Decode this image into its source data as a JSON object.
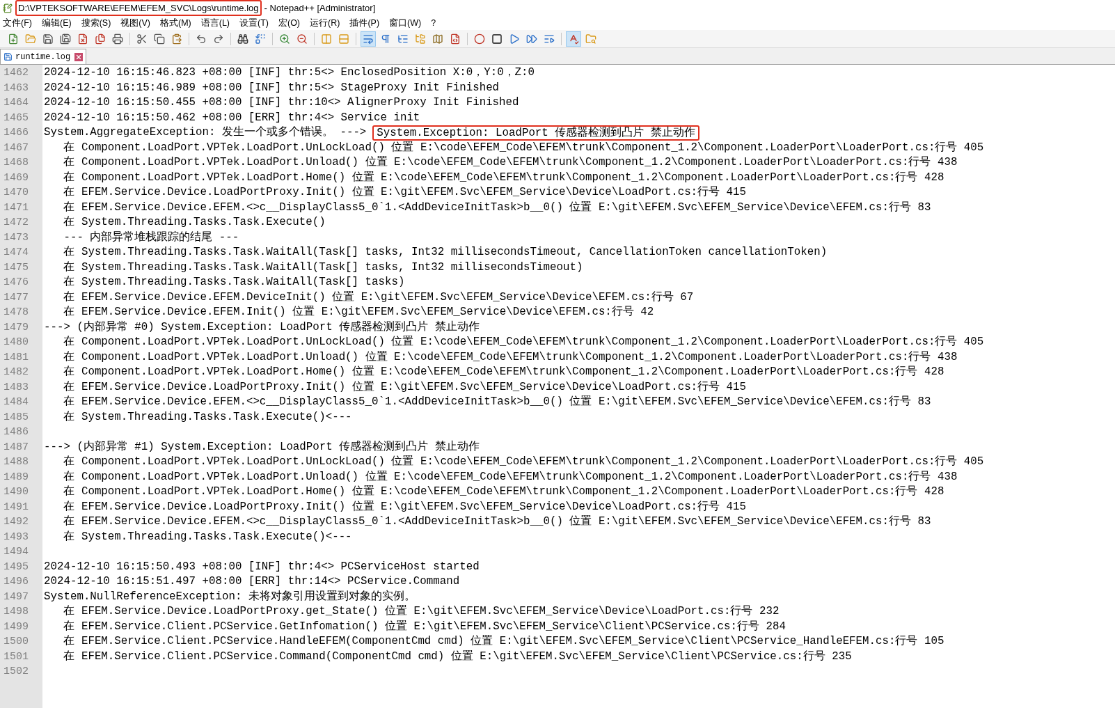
{
  "window": {
    "title_path": "D:\\VPTEKSOFTWARE\\EFEM\\EFEM_SVC\\Logs\\runtime.log",
    "title_path_highlighted": true,
    "title_app": "- Notepad++ [Administrator]"
  },
  "menu": [
    "文件(F)",
    "编辑(E)",
    "搜索(S)",
    "视图(V)",
    "格式(M)",
    "语言(L)",
    "设置(T)",
    "宏(O)",
    "运行(R)",
    "插件(P)",
    "窗口(W)",
    "?"
  ],
  "toolbar": [
    {
      "kind": "button",
      "pressed": false
    },
    {
      "kind": "button",
      "pressed": false
    },
    {
      "kind": "button",
      "pressed": false
    },
    {
      "kind": "button",
      "pressed": false
    },
    {
      "kind": "button",
      "pressed": false
    },
    {
      "kind": "button",
      "pressed": false
    },
    {
      "kind": "button",
      "pressed": false
    },
    {
      "kind": "separator"
    },
    {
      "kind": "button",
      "pressed": false
    },
    {
      "kind": "button",
      "pressed": false
    },
    {
      "kind": "button",
      "pressed": false
    },
    {
      "kind": "separator"
    },
    {
      "kind": "button",
      "pressed": false
    },
    {
      "kind": "button",
      "pressed": false
    },
    {
      "kind": "separator"
    },
    {
      "kind": "button",
      "pressed": false
    },
    {
      "kind": "button",
      "pressed": false
    },
    {
      "kind": "separator"
    },
    {
      "kind": "button",
      "pressed": false
    },
    {
      "kind": "button",
      "pressed": false
    },
    {
      "kind": "separator"
    },
    {
      "kind": "button",
      "pressed": false
    },
    {
      "kind": "button",
      "pressed": false
    },
    {
      "kind": "separator"
    },
    {
      "kind": "button",
      "pressed": true
    },
    {
      "kind": "button",
      "pressed": false
    },
    {
      "kind": "button",
      "pressed": false
    },
    {
      "kind": "button",
      "pressed": false
    },
    {
      "kind": "button",
      "pressed": false
    },
    {
      "kind": "button",
      "pressed": false
    },
    {
      "kind": "separator"
    },
    {
      "kind": "button",
      "pressed": false
    },
    {
      "kind": "button",
      "pressed": false
    },
    {
      "kind": "button",
      "pressed": false
    },
    {
      "kind": "button",
      "pressed": false
    },
    {
      "kind": "button",
      "pressed": false
    },
    {
      "kind": "separator"
    },
    {
      "kind": "button",
      "pressed": true
    },
    {
      "kind": "button",
      "pressed": false
    }
  ],
  "tabs": [
    {
      "label": "runtime.log",
      "selected": true
    }
  ],
  "editor": {
    "lines": [
      {
        "number": "1462",
        "text": "2024-12-10 16:15:46.823 +08:00 [INF] thr:5<> EnclosedPosition X:0，Y:0，Z:0"
      },
      {
        "number": "1463",
        "text": "2024-12-10 16:15:46.989 +08:00 [INF] thr:5<> StageProxy Init Finished"
      },
      {
        "number": "1464",
        "text": "2024-12-10 16:15:50.455 +08:00 [INF] thr:10<> AlignerProxy Init Finished"
      },
      {
        "number": "1465",
        "text": "2024-12-10 16:15:50.462 +08:00 [ERR] thr:4<> Service init"
      },
      {
        "number": "1466",
        "text": "System.AggregateException: 发生一个或多个错误。 --->",
        "highlighted_text": "System.Exception: LoadPort 传感器检测到凸片 禁止动作"
      },
      {
        "number": "1467",
        "text": "   在 Component.LoadPort.VPTek.LoadPort.UnLockLoad() 位置 E:\\code\\EFEM_Code\\EFEM\\trunk\\Component_1.2\\Component.LoaderPort\\LoaderPort.cs:行号 405"
      },
      {
        "number": "1468",
        "text": "   在 Component.LoadPort.VPTek.LoadPort.Unload() 位置 E:\\code\\EFEM_Code\\EFEM\\trunk\\Component_1.2\\Component.LoaderPort\\LoaderPort.cs:行号 438"
      },
      {
        "number": "1469",
        "text": "   在 Component.LoadPort.VPTek.LoadPort.Home() 位置 E:\\code\\EFEM_Code\\EFEM\\trunk\\Component_1.2\\Component.LoaderPort\\LoaderPort.cs:行号 428"
      },
      {
        "number": "1470",
        "text": "   在 EFEM.Service.Device.LoadPortProxy.Init() 位置 E:\\git\\EFEM.Svc\\EFEM_Service\\Device\\LoadPort.cs:行号 415"
      },
      {
        "number": "1471",
        "text": "   在 EFEM.Service.Device.EFEM.<>c__DisplayClass5_0`1.<AddDeviceInitTask>b__0() 位置 E:\\git\\EFEM.Svc\\EFEM_Service\\Device\\EFEM.cs:行号 83"
      },
      {
        "number": "1472",
        "text": "   在 System.Threading.Tasks.Task.Execute()"
      },
      {
        "number": "1473",
        "text": "   --- 内部异常堆栈跟踪的结尾 ---"
      },
      {
        "number": "1474",
        "text": "   在 System.Threading.Tasks.Task.WaitAll(Task[] tasks, Int32 millisecondsTimeout, CancellationToken cancellationToken)"
      },
      {
        "number": "1475",
        "text": "   在 System.Threading.Tasks.Task.WaitAll(Task[] tasks, Int32 millisecondsTimeout)"
      },
      {
        "number": "1476",
        "text": "   在 System.Threading.Tasks.Task.WaitAll(Task[] tasks)"
      },
      {
        "number": "1477",
        "text": "   在 EFEM.Service.Device.EFEM.DeviceInit() 位置 E:\\git\\EFEM.Svc\\EFEM_Service\\Device\\EFEM.cs:行号 67"
      },
      {
        "number": "1478",
        "text": "   在 EFEM.Service.Device.EFEM.Init() 位置 E:\\git\\EFEM.Svc\\EFEM_Service\\Device\\EFEM.cs:行号 42"
      },
      {
        "number": "1479",
        "text": "---> (内部异常 #0) System.Exception: LoadPort 传感器检测到凸片 禁止动作"
      },
      {
        "number": "1480",
        "text": "   在 Component.LoadPort.VPTek.LoadPort.UnLockLoad() 位置 E:\\code\\EFEM_Code\\EFEM\\trunk\\Component_1.2\\Component.LoaderPort\\LoaderPort.cs:行号 405"
      },
      {
        "number": "1481",
        "text": "   在 Component.LoadPort.VPTek.LoadPort.Unload() 位置 E:\\code\\EFEM_Code\\EFEM\\trunk\\Component_1.2\\Component.LoaderPort\\LoaderPort.cs:行号 438"
      },
      {
        "number": "1482",
        "text": "   在 Component.LoadPort.VPTek.LoadPort.Home() 位置 E:\\code\\EFEM_Code\\EFEM\\trunk\\Component_1.2\\Component.LoaderPort\\LoaderPort.cs:行号 428"
      },
      {
        "number": "1483",
        "text": "   在 EFEM.Service.Device.LoadPortProxy.Init() 位置 E:\\git\\EFEM.Svc\\EFEM_Service\\Device\\LoadPort.cs:行号 415"
      },
      {
        "number": "1484",
        "text": "   在 EFEM.Service.Device.EFEM.<>c__DisplayClass5_0`1.<AddDeviceInitTask>b__0() 位置 E:\\git\\EFEM.Svc\\EFEM_Service\\Device\\EFEM.cs:行号 83"
      },
      {
        "number": "1485",
        "text": "   在 System.Threading.Tasks.Task.Execute()<---"
      },
      {
        "number": "1486"
      },
      {
        "number": "1487",
        "text": "---> (内部异常 #1) System.Exception: LoadPort 传感器检测到凸片 禁止动作"
      },
      {
        "number": "1488",
        "text": "   在 Component.LoadPort.VPTek.LoadPort.UnLockLoad() 位置 E:\\code\\EFEM_Code\\EFEM\\trunk\\Component_1.2\\Component.LoaderPort\\LoaderPort.cs:行号 405"
      },
      {
        "number": "1489",
        "text": "   在 Component.LoadPort.VPTek.LoadPort.Unload() 位置 E:\\code\\EFEM_Code\\EFEM\\trunk\\Component_1.2\\Component.LoaderPort\\LoaderPort.cs:行号 438"
      },
      {
        "number": "1490",
        "text": "   在 Component.LoadPort.VPTek.LoadPort.Home() 位置 E:\\code\\EFEM_Code\\EFEM\\trunk\\Component_1.2\\Component.LoaderPort\\LoaderPort.cs:行号 428"
      },
      {
        "number": "1491",
        "text": "   在 EFEM.Service.Device.LoadPortProxy.Init() 位置 E:\\git\\EFEM.Svc\\EFEM_Service\\Device\\LoadPort.cs:行号 415"
      },
      {
        "number": "1492",
        "text": "   在 EFEM.Service.Device.EFEM.<>c__DisplayClass5_0`1.<AddDeviceInitTask>b__0() 位置 E:\\git\\EFEM.Svc\\EFEM_Service\\Device\\EFEM.cs:行号 83"
      },
      {
        "number": "1493",
        "text": "   在 System.Threading.Tasks.Task.Execute()<---"
      },
      {
        "number": "1494"
      },
      {
        "number": "1495",
        "text": "2024-12-10 16:15:50.493 +08:00 [INF] thr:4<> PCServiceHost started"
      },
      {
        "number": "1496",
        "text": "2024-12-10 16:15:51.497 +08:00 [ERR] thr:14<> PCService.Command"
      },
      {
        "number": "1497",
        "text": "System.NullReferenceException: 未将对象引用设置到对象的实例。"
      },
      {
        "number": "1498",
        "text": "   在 EFEM.Service.Device.LoadPortProxy.get_State() 位置 E:\\git\\EFEM.Svc\\EFEM_Service\\Device\\LoadPort.cs:行号 232"
      },
      {
        "number": "1499",
        "text": "   在 EFEM.Service.Client.PCService.GetInfomation() 位置 E:\\git\\EFEM.Svc\\EFEM_Service\\Client\\PCService.cs:行号 284"
      },
      {
        "number": "1500",
        "text": "   在 EFEM.Service.Client.PCService.HandleEFEM(ComponentCmd cmd) 位置 E:\\git\\EFEM.Svc\\EFEM_Service\\Client\\PCService_HandleEFEM.cs:行号 105"
      },
      {
        "number": "1501",
        "text": "   在 EFEM.Service.Client.PCService.Command(ComponentCmd cmd) 位置 E:\\git\\EFEM.Svc\\EFEM_Service\\Client\\PCService.cs:行号 235"
      },
      {
        "number": "1502"
      }
    ]
  }
}
